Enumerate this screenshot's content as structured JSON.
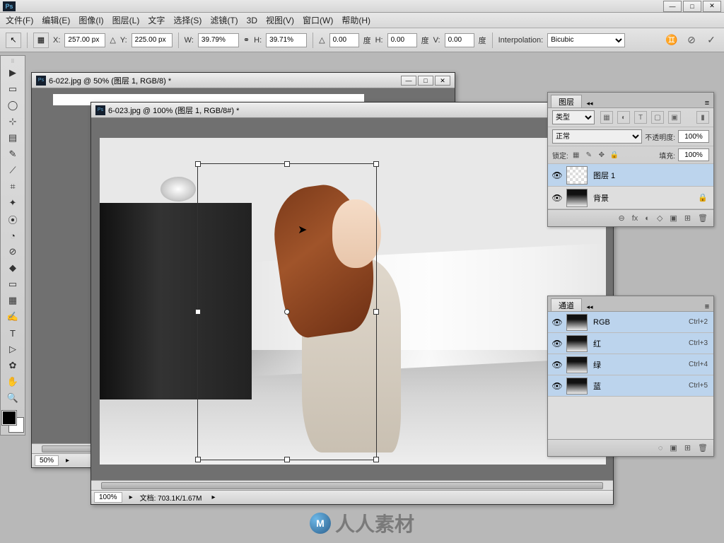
{
  "app": {
    "logo": "Ps"
  },
  "window_controls": {
    "min": "—",
    "max": "□",
    "close": "✕"
  },
  "menu": [
    "文件(F)",
    "编辑(E)",
    "图像(I)",
    "图层(L)",
    "文字",
    "选择(S)",
    "滤镜(T)",
    "3D",
    "视图(V)",
    "窗口(W)",
    "帮助(H)"
  ],
  "options": {
    "x_label": "X:",
    "x_value": "257.00 px",
    "y_label": "Y:",
    "y_value": "225.00 px",
    "w_label": "W:",
    "w_value": "39.79%",
    "h_label": "H:",
    "h_value": "39.71%",
    "angle_value": "0.00",
    "angle_unit": "度",
    "h2_label": "H:",
    "h2_value": "0.00",
    "v_label": "V:",
    "v_value": "0.00",
    "interp_label": "Interpolation:",
    "interp_value": "Bicubic"
  },
  "tools": [
    "▶",
    "▭",
    "◯",
    "⊹",
    "▤",
    "✎",
    "⟋",
    "⌗",
    "✦",
    "⦿",
    "◔",
    "⊘",
    "◆",
    "▭",
    "▦",
    "◑",
    "✍",
    "T",
    "▷",
    "✿",
    "✋",
    "🔍",
    "▤"
  ],
  "documents": [
    {
      "title": "6-022.jpg @ 50% (图层 1, RGB/8) *",
      "zoom": "50%"
    },
    {
      "title": "6-023.jpg @ 100% (图层 1, RGB/8#) *",
      "zoom": "100%",
      "status": "文档: 703.1K/1.67M"
    }
  ],
  "layers_panel": {
    "tab": "图层",
    "type_label": "类型",
    "blend_mode": "正常",
    "opacity_label": "不透明度:",
    "opacity_value": "100%",
    "lock_label": "锁定:",
    "fill_label": "填充:",
    "fill_value": "100%",
    "layers": [
      {
        "name": "图层 1",
        "locked": false
      },
      {
        "name": "背景",
        "locked": true
      }
    ],
    "footer_icons": [
      "⊖",
      "fx",
      "◐",
      "◇",
      "▣",
      "⊞",
      "🗑"
    ]
  },
  "channels_panel": {
    "tab": "通道",
    "channels": [
      {
        "name": "RGB",
        "key": "Ctrl+2"
      },
      {
        "name": "红",
        "key": "Ctrl+3"
      },
      {
        "name": "绿",
        "key": "Ctrl+4"
      },
      {
        "name": "蓝",
        "key": "Ctrl+5"
      }
    ],
    "footer_icons": [
      "◌",
      "▣",
      "⊞",
      "🗑"
    ]
  },
  "watermark": "人人素材"
}
